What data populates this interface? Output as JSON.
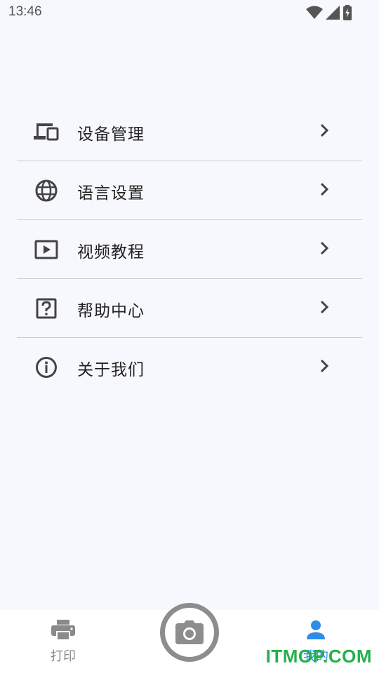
{
  "status_bar": {
    "time": "13:46",
    "icons": [
      "wifi-icon",
      "signal-icon",
      "battery-icon"
    ]
  },
  "menu": {
    "items": [
      {
        "label": "设备管理",
        "icon": "devices-icon"
      },
      {
        "label": "语言设置",
        "icon": "globe-icon"
      },
      {
        "label": "视频教程",
        "icon": "video-icon"
      },
      {
        "label": "帮助中心",
        "icon": "help-icon"
      },
      {
        "label": "关于我们",
        "icon": "info-icon"
      }
    ]
  },
  "bottom_nav": {
    "print_label": "打印",
    "camera_icon": "camera-icon",
    "mine_label": "我的",
    "active_color": "#2d8ce8",
    "inactive_color": "#8a8a8a"
  },
  "watermark": "ITMOP.COM"
}
